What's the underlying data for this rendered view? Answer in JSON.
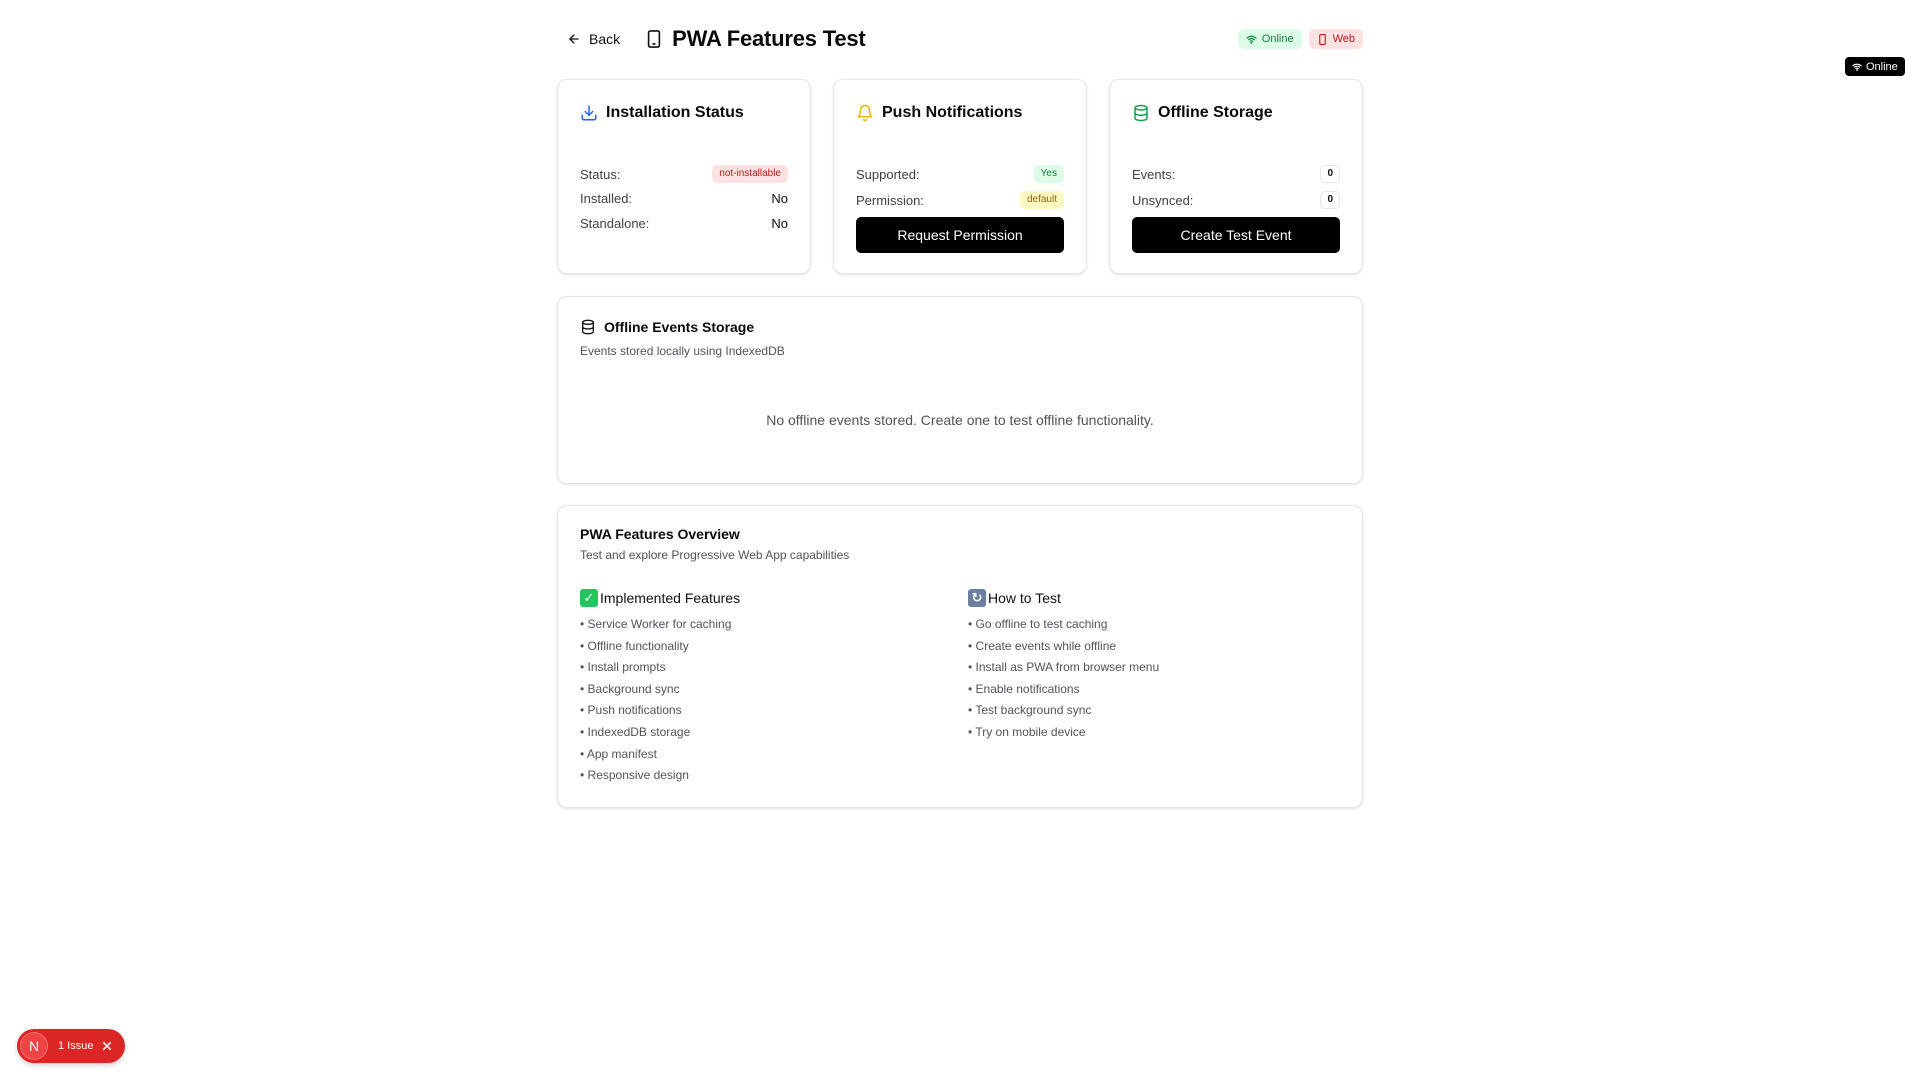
{
  "header": {
    "back_label": "Back",
    "title": "PWA Features Test",
    "badge_online": "Online",
    "badge_web": "Web"
  },
  "installation": {
    "title": "Installation Status",
    "status_label": "Status:",
    "status_value": "not-installable",
    "installed_label": "Installed:",
    "installed_value": "No",
    "standalone_label": "Standalone:",
    "standalone_value": "No"
  },
  "push": {
    "title": "Push Notifications",
    "supported_label": "Supported:",
    "supported_value": "Yes",
    "permission_label": "Permission:",
    "permission_value": "default",
    "button_label": "Request Permission"
  },
  "storage": {
    "title": "Offline Storage",
    "events_label": "Events:",
    "events_value": "0",
    "unsynced_label": "Unsynced:",
    "unsynced_value": "0",
    "button_label": "Create Test Event"
  },
  "events_section": {
    "title": "Offline Events Storage",
    "subtitle": "Events stored locally using IndexedDB",
    "empty_message": "No offline events stored. Create one to test offline functionality."
  },
  "overview": {
    "title": "PWA Features Overview",
    "subtitle": "Test and explore Progressive Web App capabilities",
    "implemented": {
      "heading": "Implemented Features",
      "items": [
        "• Service Worker for caching",
        "• Offline functionality",
        "• Install prompts",
        "• Background sync",
        "• Push notifications",
        "• IndexedDB storage",
        "• App manifest",
        "• Responsive design"
      ]
    },
    "how_to": {
      "heading": "How to Test",
      "items": [
        "• Go offline to test caching",
        "• Create events while offline",
        "• Install as PWA from browser menu",
        "• Enable notifications",
        "• Test background sync",
        "• Try on mobile device"
      ]
    }
  },
  "float_status": {
    "label": "Online"
  },
  "dev_overlay": {
    "logo": "N",
    "issues_label": "1 Issue"
  },
  "colors": {
    "accent_blue": "#2563eb",
    "accent_yellow": "#eab308",
    "accent_green": "#16a34a",
    "error_red": "#dc2626"
  }
}
